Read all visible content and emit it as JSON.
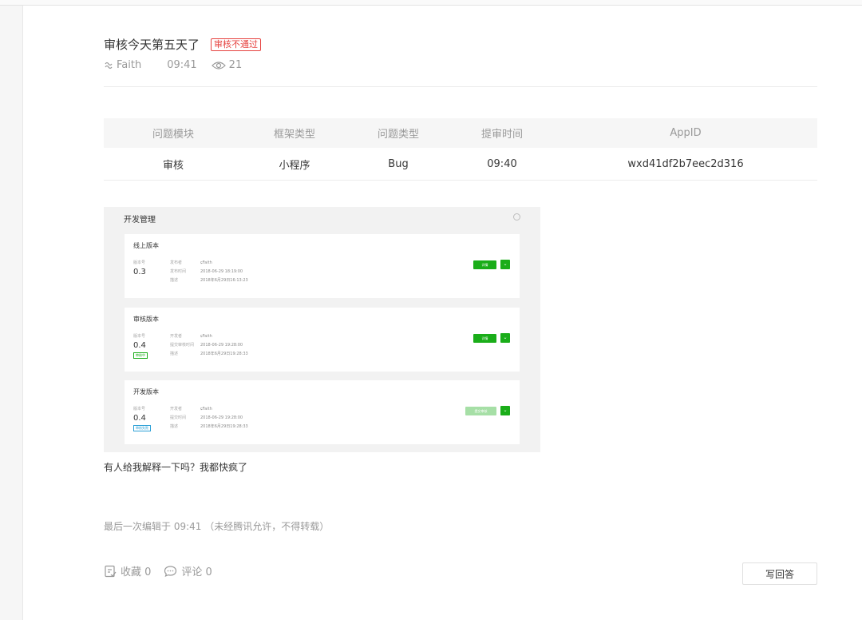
{
  "post": {
    "title": "审核今天第五天了",
    "status_badge": "审核不通过",
    "author": "Faith",
    "time": "09:41",
    "views": "21"
  },
  "info_table": {
    "headers": [
      "问题模块",
      "框架类型",
      "问题类型",
      "提审时间",
      "AppID"
    ],
    "row": [
      "审核",
      "小程序",
      "Bug",
      "09:40",
      "wxd41df2b7eec2d316"
    ]
  },
  "screenshot": {
    "title": "开发管理",
    "cards": [
      {
        "title": "线上版本",
        "version_label": "版本号",
        "version": "0.3",
        "tag": "",
        "rows": [
          {
            "k": "发布者",
            "v": "Faith"
          },
          {
            "k": "发布时间",
            "v": "2018-06-29 18:19:00"
          },
          {
            "k": "描述",
            "v": "2018年6月29日16:13:23"
          }
        ],
        "button": "详情"
      },
      {
        "title": "审核版本",
        "version_label": "版本号",
        "version": "0.4",
        "tag": "审核中",
        "rows": [
          {
            "k": "开发者",
            "v": "Faith"
          },
          {
            "k": "提交审核时间",
            "v": "2018-06-29 19:28:00"
          },
          {
            "k": "描述",
            "v": "2018年6月29日19:28:33"
          }
        ],
        "button": "详情"
      },
      {
        "title": "开发版本",
        "version_label": "版本号",
        "version": "0.4",
        "tag": "审核失败",
        "rows": [
          {
            "k": "开发者",
            "v": "Faith"
          },
          {
            "k": "提交时间",
            "v": "2018-06-29 19:28:00"
          },
          {
            "k": "描述",
            "v": "2018年6月29日19:28:33"
          }
        ],
        "button": "提交审核"
      }
    ]
  },
  "question_text": "有人给我解释一下吗？我都快疯了",
  "edited_text": "最后一次编辑于  09:41  （未经腾讯允许，不得转载）",
  "actions": {
    "favorite": "收藏 0",
    "comment": "评论 0",
    "answer_button": "写回答"
  },
  "colors": {
    "brand_green": "#1aad19",
    "danger_red": "#e64340",
    "muted_gray": "#9a9a9a"
  }
}
